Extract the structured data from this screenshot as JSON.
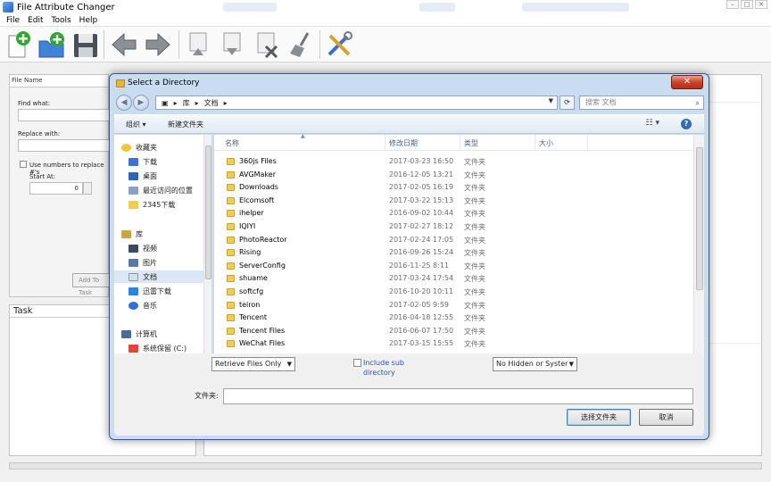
{
  "app": {
    "title": "File Attribute Changer",
    "menu": [
      "File",
      "Edit",
      "Tools",
      "Help"
    ],
    "left_panel": {
      "header": "File Name",
      "find_label": "Find what:",
      "replace_label": "Replace with:",
      "use_numbers_label": "Use numbers to replace #'s",
      "start_at_label": "Start At:",
      "start_at_value": "0",
      "add_button": "Add To Task"
    },
    "task_panel": {
      "header": "Task"
    }
  },
  "dialog": {
    "title": "Select a Directory",
    "close_label": "✕",
    "address": {
      "root": "库",
      "current": "文档"
    },
    "search_placeholder": "搜索 文档",
    "toolbar": {
      "organize": "组织 ▾",
      "new_folder": "新建文件夹"
    },
    "nav": {
      "favorites": {
        "label": "收藏夹",
        "items": [
          "下载",
          "桌面",
          "最近访问的位置",
          "2345下载"
        ]
      },
      "libraries": {
        "label": "库",
        "items": [
          "视频",
          "图片",
          "文档",
          "迅雷下载",
          "音乐"
        ]
      },
      "computer": {
        "label": "计算机",
        "items": [
          "系统保留 (C:)"
        ]
      }
    },
    "columns": {
      "name": "名称",
      "date": "修改日期",
      "type": "类型",
      "size": "大小"
    },
    "files": [
      {
        "name": "360js Files",
        "date": "2017-03-23 16:50",
        "type": "文件夹"
      },
      {
        "name": "AVGMaker",
        "date": "2016-12-05 13:21",
        "type": "文件夹"
      },
      {
        "name": "Downloads",
        "date": "2017-02-05 16:19",
        "type": "文件夹"
      },
      {
        "name": "Elcomsoft",
        "date": "2017-03-22 15:13",
        "type": "文件夹"
      },
      {
        "name": "ihelper",
        "date": "2016-09-02 10:44",
        "type": "文件夹"
      },
      {
        "name": "IQIYI",
        "date": "2017-02-27 18:12",
        "type": "文件夹"
      },
      {
        "name": "PhotoReactor",
        "date": "2017-02-24 17:05",
        "type": "文件夹"
      },
      {
        "name": "Rising",
        "date": "2016-09-26 15:24",
        "type": "文件夹"
      },
      {
        "name": "ServerConfig",
        "date": "2016-11-25 8:11",
        "type": "文件夹"
      },
      {
        "name": "shuame",
        "date": "2017-03-24 17:54",
        "type": "文件夹"
      },
      {
        "name": "softcfg",
        "date": "2016-10-20 10:11",
        "type": "文件夹"
      },
      {
        "name": "teiron",
        "date": "2017-02-05 9:59",
        "type": "文件夹"
      },
      {
        "name": "Tencent",
        "date": "2016-04-18 12:55",
        "type": "文件夹"
      },
      {
        "name": "Tencent Files",
        "date": "2016-06-07 17:50",
        "type": "文件夹"
      },
      {
        "name": "WeChat Files",
        "date": "2017-03-15 15:55",
        "type": "文件夹"
      }
    ],
    "options": {
      "retrieve": "Retrieve Files Only",
      "include_sub": "Include sub directory",
      "hidden": "No Hidden or System"
    },
    "folder_label": "文件夹:",
    "folder_value": "",
    "ok_button": "选择文件夹",
    "cancel_button": "取消"
  },
  "colors": {
    "dialog_frame": "#c9dcf2",
    "close_red": "#c9452c",
    "link_blue": "#2a55a6",
    "folder_yellow": "#f1cc55"
  }
}
